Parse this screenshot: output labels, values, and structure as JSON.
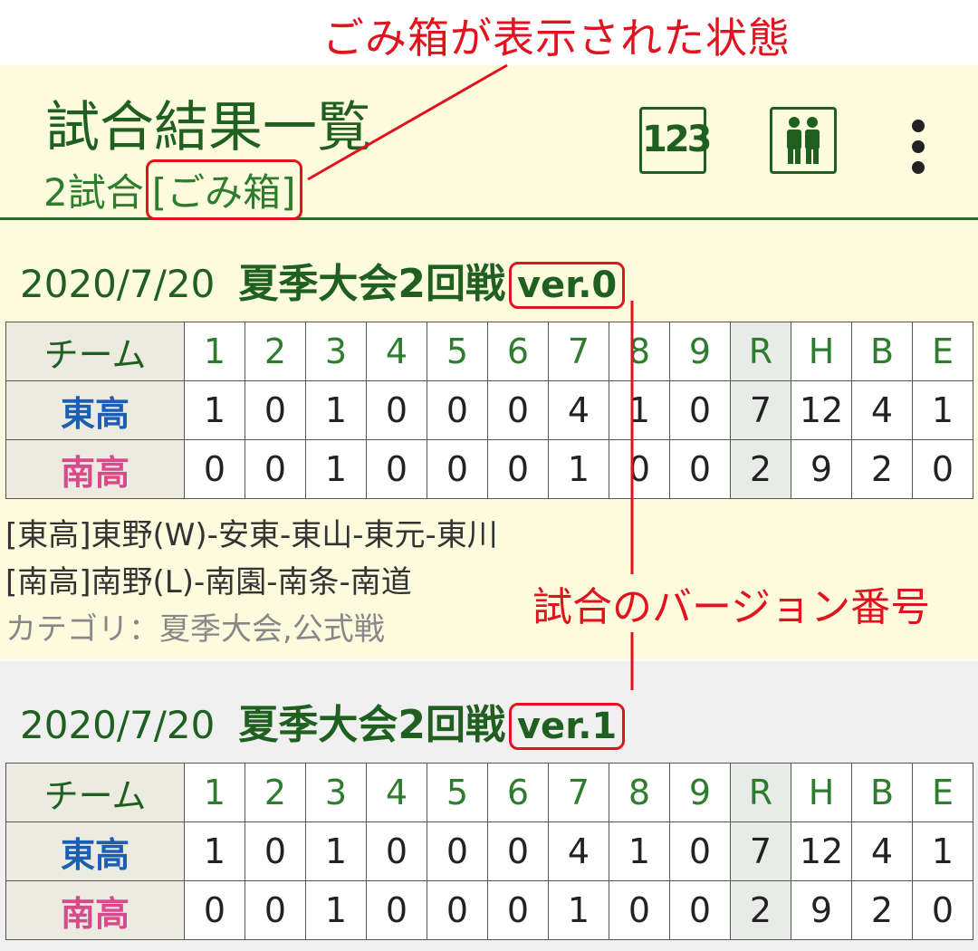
{
  "annotations": {
    "trash_state": "ごみ箱が表示された状態",
    "version_number": "試合のバージョン番号"
  },
  "header": {
    "title": "試合結果一覧",
    "count": "2試合",
    "trash_label": "[ごみ箱]",
    "icons": [
      "score-123-icon",
      "players-icon",
      "more-vert-icon"
    ],
    "score_icon_text": "123"
  },
  "games": [
    {
      "date": "2020/7/20",
      "title": "夏季大会2回戦",
      "version": "ver.0",
      "columns": [
        "チーム",
        "1",
        "2",
        "3",
        "4",
        "5",
        "6",
        "7",
        "8",
        "9",
        "R",
        "H",
        "B",
        "E"
      ],
      "rows": [
        {
          "team": "東高",
          "cells": [
            "1",
            "0",
            "1",
            "0",
            "0",
            "0",
            "4",
            "1",
            "0",
            "7",
            "12",
            "4",
            "1"
          ]
        },
        {
          "team": "南高",
          "cells": [
            "0",
            "0",
            "1",
            "0",
            "0",
            "0",
            "1",
            "0",
            "0",
            "2",
            "9",
            "2",
            "0"
          ]
        }
      ],
      "pitchers_east": "[東高]東野(W)-安東-東山-東元-東川",
      "pitchers_south": "[南高]南野(L)-南園-南条-南道",
      "category": "カテゴリ：夏季大会,公式戦"
    },
    {
      "date": "2020/7/20",
      "title": "夏季大会2回戦",
      "version": "ver.1",
      "columns": [
        "チーム",
        "1",
        "2",
        "3",
        "4",
        "5",
        "6",
        "7",
        "8",
        "9",
        "R",
        "H",
        "B",
        "E"
      ],
      "rows": [
        {
          "team": "東高",
          "cells": [
            "1",
            "0",
            "1",
            "0",
            "0",
            "0",
            "4",
            "1",
            "0",
            "7",
            "12",
            "4",
            "1"
          ]
        },
        {
          "team": "南高",
          "cells": [
            "0",
            "0",
            "1",
            "0",
            "0",
            "0",
            "1",
            "0",
            "0",
            "2",
            "9",
            "2",
            "0"
          ]
        }
      ]
    }
  ],
  "colors": {
    "annotation_red": "#e0141e",
    "header_bg": "#fdfbde",
    "primary_green": "#1f5f1f",
    "team_east": "#1a5fb4",
    "team_south": "#d94a8c"
  }
}
